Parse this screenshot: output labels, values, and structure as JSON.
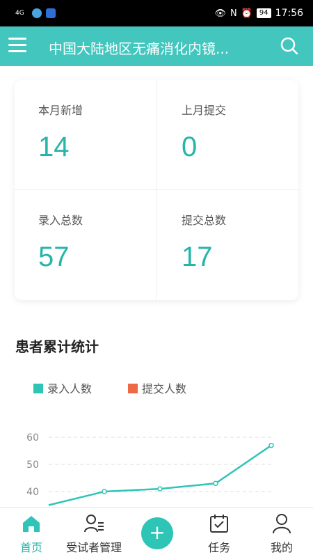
{
  "status_bar": {
    "network": "4G",
    "battery": "94",
    "time": "17:56"
  },
  "topbar": {
    "title": "中国大陆地区无痛消化内镜..."
  },
  "stats": [
    {
      "label": "本月新增",
      "value": "14"
    },
    {
      "label": "上月提交",
      "value": "0"
    },
    {
      "label": "录入总数",
      "value": "57"
    },
    {
      "label": "提交总数",
      "value": "17"
    }
  ],
  "section": {
    "title": "患者累计统计"
  },
  "legend": [
    {
      "label": "录入人数",
      "color": "#2ec4b6"
    },
    {
      "label": "提交人数",
      "color": "#ee6a45"
    }
  ],
  "chart_data": {
    "type": "line",
    "series": [
      {
        "name": "录入人数",
        "color": "#2ec4b6",
        "values": [
          35,
          40,
          41,
          43,
          57
        ]
      }
    ],
    "ylim": [
      30,
      60
    ],
    "yticks": [
      "60",
      "50",
      "40"
    ]
  },
  "tabbar": {
    "items": [
      {
        "label": "首页",
        "icon": "home-icon"
      },
      {
        "label": "受试者管理",
        "icon": "subject-manage-icon"
      },
      {
        "label": "任务",
        "icon": "task-icon"
      },
      {
        "label": "我的",
        "icon": "profile-icon"
      }
    ],
    "add_label": "+"
  },
  "colors": {
    "accent": "#43c6bd",
    "value": "#26b5a9"
  }
}
